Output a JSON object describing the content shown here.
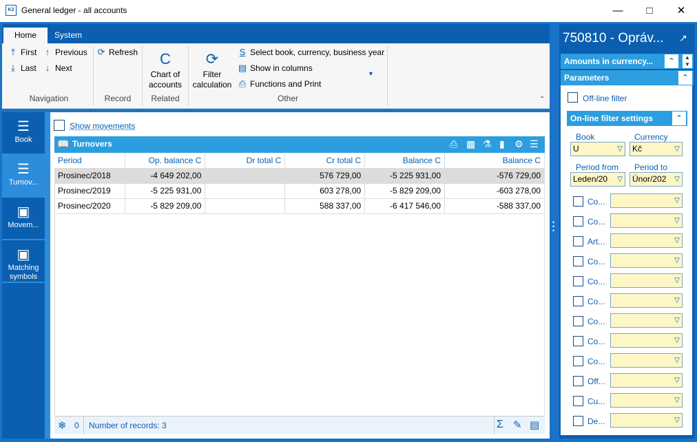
{
  "window": {
    "title": "General ledger - all accounts",
    "app_icon": "K2"
  },
  "ribbon": {
    "tabs": [
      {
        "label": "Home",
        "active": true
      },
      {
        "label": "System",
        "active": false
      }
    ],
    "navigation": {
      "first": "First",
      "previous": "Previous",
      "last": "Last",
      "next": "Next",
      "label": "Navigation"
    },
    "record": {
      "refresh": "Refresh",
      "label": "Record"
    },
    "related": {
      "chart_line1": "Chart of",
      "chart_line2": "accounts",
      "label": "Related"
    },
    "other": {
      "filter_line1": "Filter",
      "filter_line2": "calculation",
      "select": "Select book, currency, business year",
      "columns": "Show in columns",
      "functions": "Functions and Print",
      "label": "Other"
    }
  },
  "leftnav": {
    "items": [
      {
        "label": "Book",
        "icon": "menu-icon",
        "active": false
      },
      {
        "label": "Turnov...",
        "icon": "list-icon",
        "active": true
      },
      {
        "label": "Movem...",
        "icon": "box-icon",
        "active": false
      },
      {
        "label": "Matching symbols",
        "icon": "box-icon",
        "active": false
      }
    ]
  },
  "content": {
    "show_movements": "Show movements",
    "grid_title": "Turnovers",
    "columns": [
      "Period",
      "Op. balance C",
      "Dr total C",
      "Cr total C",
      "Balance C",
      "Balance C"
    ],
    "rows": [
      [
        "Prosinec/2018",
        "-4 649 202,00",
        "",
        "576 729,00",
        "-5 225 931,00",
        "-576 729,00"
      ],
      [
        "Prosinec/2019",
        "-5 225 931,00",
        "",
        "603 278,00",
        "-5 829 209,00",
        "-603 278,00"
      ],
      [
        "Prosinec/2020",
        "-5 829 209,00",
        "",
        "588 337,00",
        "-6 417 546,00",
        "-588 337,00"
      ]
    ],
    "status_count": "0",
    "status_records": "Number of records: 3"
  },
  "rpanel": {
    "title": "750810 - Opráv...",
    "amounts_header": "Amounts in currency...",
    "params_header": "Parameters",
    "offline_filter": "Off-line filter",
    "online_header": "On-line filter settings",
    "book_label": "Book",
    "book_value": "U",
    "currency_label": "Currency",
    "currency_value": "Kč",
    "period_from_label": "Period from",
    "period_from_value": "Leden/20",
    "period_to_label": "Period to",
    "period_to_value": "Únor/202",
    "filters": [
      "Co...",
      "Co...",
      "Art...",
      "Co...",
      "Co...",
      "Co...",
      "Co...",
      "Co...",
      "Co...",
      "Off...",
      "Cu...",
      "De..."
    ]
  }
}
